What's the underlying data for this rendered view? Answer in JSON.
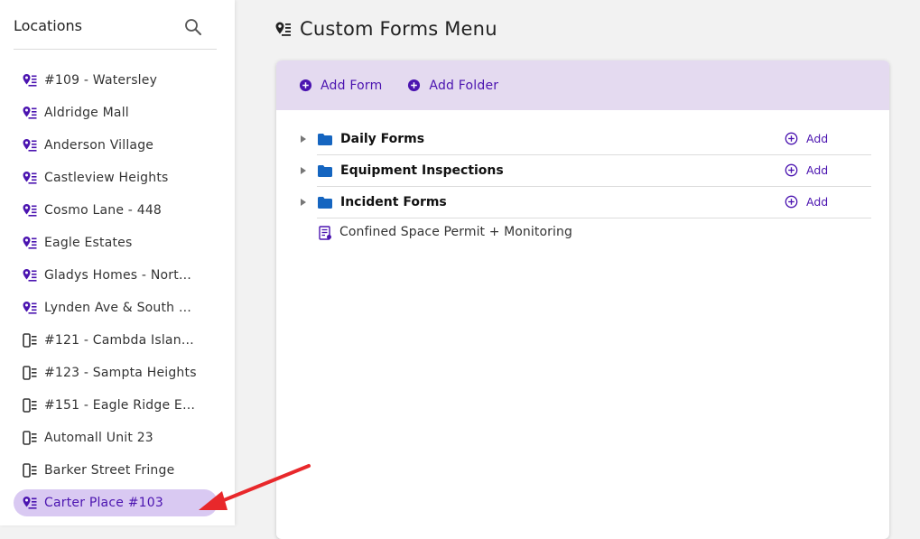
{
  "sidebar": {
    "title": "Locations",
    "search_icon": "search-icon",
    "items": [
      {
        "label": "#109 - Watersley",
        "icon": "location-pin-list-icon"
      },
      {
        "label": "Aldridge Mall",
        "icon": "location-pin-list-icon"
      },
      {
        "label": "Anderson Village",
        "icon": "location-pin-list-icon"
      },
      {
        "label": "Castleview Heights",
        "icon": "location-pin-list-icon"
      },
      {
        "label": "Cosmo Lane - 448",
        "icon": "location-pin-list-icon"
      },
      {
        "label": "Eagle Estates",
        "icon": "location-pin-list-icon"
      },
      {
        "label": "Gladys Homes - North …",
        "icon": "location-pin-list-icon"
      },
      {
        "label": "Lynden Ave & South Fr…",
        "icon": "location-pin-list-icon"
      },
      {
        "label": "#121 - Cambda Island D…",
        "icon": "mobile-list-icon"
      },
      {
        "label": "#123 - Sampta Heights",
        "icon": "mobile-list-icon"
      },
      {
        "label": "#151 - Eagle Ridge Esta…",
        "icon": "mobile-list-icon"
      },
      {
        "label": "Automall Unit 23",
        "icon": "mobile-list-icon"
      },
      {
        "label": "Barker Street Fringe",
        "icon": "mobile-list-icon"
      },
      {
        "label": "Carter Place #103",
        "icon": "location-pin-list-icon",
        "selected": true
      }
    ]
  },
  "main": {
    "title": "Custom Forms Menu",
    "toolbar": {
      "add_form": "Add Form",
      "add_folder": "Add Folder"
    },
    "folders": [
      {
        "name": "Daily Forms",
        "add_label": "Add"
      },
      {
        "name": "Equipment Inspections",
        "add_label": "Add"
      },
      {
        "name": "Incident Forms",
        "add_label": "Add"
      }
    ],
    "forms": [
      {
        "name": "Confined Space Permit + Monitoring"
      }
    ]
  },
  "colors": {
    "accent": "#4b14b0",
    "header_bg": "#e4daf0",
    "selected_bg": "#d9c9f2",
    "folder": "#1565c0",
    "annotation_arrow": "#e8282b"
  }
}
